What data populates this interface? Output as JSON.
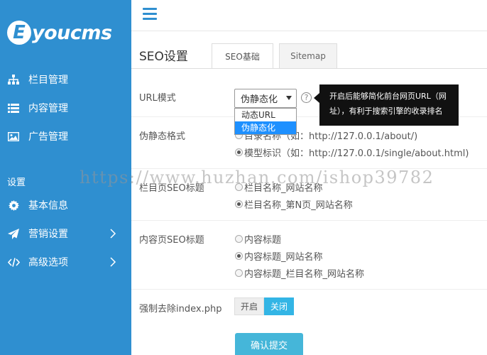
{
  "brand": {
    "logo_letter": "E",
    "logo_text": "youcms"
  },
  "sidebar": {
    "items": [
      {
        "label": "栏目管理",
        "icon": "sitemap-icon"
      },
      {
        "label": "内容管理",
        "icon": "list-icon"
      },
      {
        "label": "广告管理",
        "icon": "image-icon"
      }
    ],
    "section_title": "设置",
    "settings": [
      {
        "label": "基本信息",
        "icon": "gear-icon",
        "has_submenu": false
      },
      {
        "label": "营销设置",
        "icon": "send-icon",
        "has_submenu": true
      },
      {
        "label": "高级选项",
        "icon": "code-icon",
        "has_submenu": true
      }
    ]
  },
  "main": {
    "title": "SEO设置",
    "tabs": [
      {
        "label": "SEO基础",
        "active": true
      },
      {
        "label": "Sitemap",
        "active": false
      }
    ],
    "url_mode": {
      "label": "URL模式",
      "selected": "伪静态化",
      "options": [
        "动态URL",
        "伪静态化"
      ],
      "help_glyph": "?",
      "tooltip": "开启后能够简化前台网页URL（网址），有利于搜索引擎的收录排名"
    },
    "pseudo_format": {
      "label": "伪静态格式",
      "options": [
        {
          "text": "目录名称（如：http://127.0.0.1/about/)",
          "checked": false
        },
        {
          "text": "模型标识（如：http://127.0.0.1/single/about.html)",
          "checked": true
        }
      ]
    },
    "list_seo_title": {
      "label": "栏目页SEO标题",
      "options": [
        {
          "text": "栏目名称_网站名称",
          "checked": false
        },
        {
          "text": "栏目名称_第N页_网站名称",
          "checked": true
        }
      ]
    },
    "content_seo_title": {
      "label": "内容页SEO标题",
      "options": [
        {
          "text": "内容标题",
          "checked": false
        },
        {
          "text": "内容标题_网站名称",
          "checked": true
        },
        {
          "text": "内容标题_栏目名称_网站名称",
          "checked": false
        }
      ]
    },
    "remove_index": {
      "label": "强制去除index.php",
      "on_label": "开启",
      "off_label": "关闭",
      "active": "关闭"
    },
    "submit_label": "确认提交"
  },
  "watermark": "https://www.huzhan.com/ishop39782",
  "colors": {
    "sidebar": "#2f8fd0",
    "accent": "#33b5e5",
    "submit": "#45b6d9"
  }
}
